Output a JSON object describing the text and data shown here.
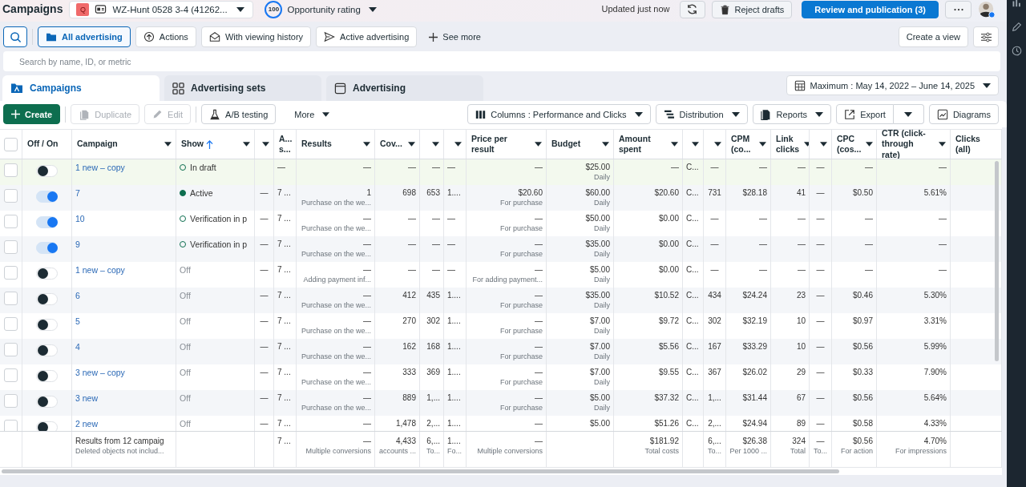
{
  "header": {
    "title": "Campaigns",
    "account": {
      "initial": "Q",
      "name": "WZ-Hunt 0528 3-4 (41262..."
    },
    "opportunity": {
      "score": "100",
      "label": "Opportunity rating"
    },
    "updated": "Updated just now",
    "reject": "Reject drafts",
    "publish": "Review and publication (3)"
  },
  "filters": [
    {
      "label": "All advertising",
      "selected": true
    },
    {
      "label": "Actions",
      "selected": false
    },
    {
      "label": "With viewing history",
      "selected": false
    },
    {
      "label": "Active advertising",
      "selected": false
    }
  ],
  "see_more": "See more",
  "create_view": "Create a view",
  "search": {
    "placeholder": "Search by name, ID, or metric"
  },
  "tabs": [
    {
      "label": "Campaigns",
      "selected": true
    },
    {
      "label": "Advertising sets",
      "selected": false
    },
    {
      "label": "Advertising",
      "selected": false
    }
  ],
  "date_range": "Maximum : May 14, 2022 – June 14, 2025",
  "toolbar": {
    "actions": [
      {
        "label": "Create",
        "disabled": false
      },
      {
        "label": "Duplicate",
        "disabled": true
      },
      {
        "label": "Edit",
        "disabled": true
      },
      {
        "label": "A/B testing",
        "disabled": false
      }
    ],
    "more": "More",
    "tools": [
      {
        "label": "Columns : Performance and Clicks",
        "kind": "menu"
      },
      {
        "label": "Distribution",
        "kind": "menu"
      },
      {
        "label": "Reports",
        "kind": "menu"
      },
      {
        "label": "Export",
        "kind": "split"
      },
      {
        "label": "Diagrams",
        "kind": "plain"
      }
    ]
  },
  "table": {
    "select_all": false,
    "fixed_columns": [
      {
        "label": "Off / On",
        "dropdown": false
      },
      {
        "label": "Campaign",
        "dropdown": true,
        "sorted": false
      },
      {
        "label": "Show",
        "dropdown": true,
        "sorted": true
      }
    ],
    "columns": [
      {
        "dropdown": true
      },
      {
        "label": "A... s..."
      },
      {
        "label": "Results",
        "dropdown": true
      },
      {
        "label": "Cov...",
        "dropdown": true
      },
      {
        "dropdown": true
      },
      {
        "dropdown": true
      },
      {
        "label": "Price per result",
        "dropdown": true
      },
      {
        "label": "Budget",
        "dropdown": true
      },
      {
        "label": "Amount spent",
        "dropdown": true
      },
      {
        "dropdown": true
      },
      {
        "dropdown": true
      },
      {
        "label": "CPM (co...",
        "dropdown": true
      },
      {
        "label": "Link clicks",
        "dropdown": true
      },
      {
        "dropdown": true
      },
      {
        "label": "CPC (cos...",
        "dropdown": true
      },
      {
        "label": "CTR (click-through rate)",
        "dropdown": true
      },
      {
        "label": "Clicks (all)",
        "dropdown": false
      }
    ],
    "rows": [
      {
        "selected": false,
        "on": false,
        "campaign": "1 new – copy",
        "status": {
          "label": "In draft",
          "kind": "draft"
        },
        "cells": [
          null,
          [
            "—"
          ],
          [
            "—"
          ],
          [
            "—"
          ],
          [
            "—"
          ],
          [
            "—"
          ],
          [
            "—"
          ],
          [
            "$25.00",
            "Daily"
          ],
          [
            "—"
          ],
          [
            "C..."
          ],
          [
            "—"
          ],
          [
            "—"
          ],
          [
            "—"
          ],
          [
            "—"
          ],
          [
            "—"
          ],
          [
            "—"
          ]
        ]
      },
      {
        "selected": false,
        "on": true,
        "campaign": "7",
        "status": {
          "label": "Active",
          "kind": "active"
        },
        "cells": [
          [
            "—"
          ],
          [
            "7 ..."
          ],
          [
            "1",
            "Purchase on the we..."
          ],
          [
            "698"
          ],
          [
            "653"
          ],
          [
            "1...."
          ],
          [
            "$20.60",
            "For purchase"
          ],
          [
            "$60.00",
            "Daily"
          ],
          [
            "$20.60"
          ],
          [
            "C..."
          ],
          [
            "731"
          ],
          [
            "$28.18"
          ],
          [
            "41"
          ],
          [
            "—"
          ],
          [
            "$0.50"
          ],
          [
            "5.61%"
          ]
        ]
      },
      {
        "selected": false,
        "on": true,
        "campaign": "10",
        "status": {
          "label": "Verification in p",
          "kind": "review"
        },
        "cells": [
          [
            "—"
          ],
          [
            "7 ..."
          ],
          [
            "—",
            "Purchase on the we..."
          ],
          [
            "—"
          ],
          [
            "—"
          ],
          [
            "—"
          ],
          [
            "—",
            "For purchase"
          ],
          [
            "$50.00",
            "Daily"
          ],
          [
            "$0.00"
          ],
          [
            "C..."
          ],
          [
            "—"
          ],
          [
            "—"
          ],
          [
            "—"
          ],
          [
            "—"
          ],
          [
            "—"
          ],
          [
            "—"
          ]
        ]
      },
      {
        "selected": false,
        "on": true,
        "campaign": "9",
        "status": {
          "label": "Verification in p",
          "kind": "review"
        },
        "cells": [
          [
            "—"
          ],
          [
            "7 ..."
          ],
          [
            "—",
            "Purchase on the we..."
          ],
          [
            "—"
          ],
          [
            "—"
          ],
          [
            "—"
          ],
          [
            "—",
            "For purchase"
          ],
          [
            "$35.00",
            "Daily"
          ],
          [
            "$0.00"
          ],
          [
            "C..."
          ],
          [
            "—"
          ],
          [
            "—"
          ],
          [
            "—"
          ],
          [
            "—"
          ],
          [
            "—"
          ],
          [
            "—"
          ]
        ]
      },
      {
        "selected": false,
        "on": false,
        "campaign": "1 new – copy",
        "status": {
          "label": "Off",
          "kind": "off"
        },
        "cells": [
          [
            "—"
          ],
          [
            "7 ..."
          ],
          [
            "—",
            "Adding payment inf..."
          ],
          [
            "—"
          ],
          [
            "—"
          ],
          [
            "—"
          ],
          [
            "—",
            "For adding payment..."
          ],
          [
            "$5.00",
            "Daily"
          ],
          [
            "$0.00"
          ],
          [
            "C..."
          ],
          [
            "—"
          ],
          [
            "—"
          ],
          [
            "—"
          ],
          [
            "—"
          ],
          [
            "—"
          ],
          [
            "—"
          ]
        ]
      },
      {
        "selected": false,
        "on": false,
        "campaign": "6",
        "status": {
          "label": "Off",
          "kind": "off"
        },
        "cells": [
          [
            "—"
          ],
          [
            "7 ..."
          ],
          [
            "—",
            "Purchase on the we..."
          ],
          [
            "412"
          ],
          [
            "435"
          ],
          [
            "1...."
          ],
          [
            "—",
            "For purchase"
          ],
          [
            "$35.00",
            "Daily"
          ],
          [
            "$10.52"
          ],
          [
            "C..."
          ],
          [
            "434"
          ],
          [
            "$24.24"
          ],
          [
            "23"
          ],
          [
            "—"
          ],
          [
            "$0.46"
          ],
          [
            "5.30%"
          ]
        ]
      },
      {
        "selected": false,
        "on": false,
        "campaign": "5",
        "status": {
          "label": "Off",
          "kind": "off"
        },
        "cells": [
          [
            "—"
          ],
          [
            "7 ..."
          ],
          [
            "—",
            "Purchase on the we..."
          ],
          [
            "270"
          ],
          [
            "302"
          ],
          [
            "1...."
          ],
          [
            "—",
            "For purchase"
          ],
          [
            "$7.00",
            "Daily"
          ],
          [
            "$9.72"
          ],
          [
            "C..."
          ],
          [
            "302"
          ],
          [
            "$32.19"
          ],
          [
            "10"
          ],
          [
            "—"
          ],
          [
            "$0.97"
          ],
          [
            "3.31%"
          ]
        ]
      },
      {
        "selected": false,
        "on": false,
        "campaign": "4",
        "status": {
          "label": "Off",
          "kind": "off"
        },
        "cells": [
          [
            "—"
          ],
          [
            "7 ..."
          ],
          [
            "—",
            "Purchase on the we..."
          ],
          [
            "162"
          ],
          [
            "168"
          ],
          [
            "1...."
          ],
          [
            "—",
            "For purchase"
          ],
          [
            "$7.00",
            "Daily"
          ],
          [
            "$5.56"
          ],
          [
            "C..."
          ],
          [
            "167"
          ],
          [
            "$33.29"
          ],
          [
            "10"
          ],
          [
            "—"
          ],
          [
            "$0.56"
          ],
          [
            "5.99%"
          ]
        ]
      },
      {
        "selected": false,
        "on": false,
        "campaign": "3 new – copy",
        "status": {
          "label": "Off",
          "kind": "off"
        },
        "cells": [
          [
            "—"
          ],
          [
            "7 ..."
          ],
          [
            "—",
            "Purchase on the we..."
          ],
          [
            "333"
          ],
          [
            "369"
          ],
          [
            "1...."
          ],
          [
            "—",
            "For purchase"
          ],
          [
            "$7.00",
            "Daily"
          ],
          [
            "$9.55"
          ],
          [
            "C..."
          ],
          [
            "367"
          ],
          [
            "$26.02"
          ],
          [
            "29"
          ],
          [
            "—"
          ],
          [
            "$0.33"
          ],
          [
            "7.90%"
          ]
        ]
      },
      {
        "selected": false,
        "on": false,
        "campaign": "3 new",
        "status": {
          "label": "Off",
          "kind": "off"
        },
        "cells": [
          [
            "—"
          ],
          [
            "7 ..."
          ],
          [
            "—",
            "Purchase on the we..."
          ],
          [
            "889"
          ],
          [
            "1,..."
          ],
          [
            "1...."
          ],
          [
            "—",
            "For purchase"
          ],
          [
            "$5.00",
            "Daily"
          ],
          [
            "$37.32"
          ],
          [
            "C..."
          ],
          [
            "1,..."
          ],
          [
            "$31.44"
          ],
          [
            "67"
          ],
          [
            "—"
          ],
          [
            "$0.56"
          ],
          [
            "5.64%"
          ]
        ]
      },
      {
        "selected": false,
        "on": false,
        "campaign": "2 new",
        "status": {
          "label": "Off",
          "kind": "off"
        },
        "cells": [
          [
            "—"
          ],
          [
            "7 ..."
          ],
          [
            "—"
          ],
          [
            "1,478"
          ],
          [
            "2,..."
          ],
          [
            "1...."
          ],
          [
            "—"
          ],
          [
            "$5.00"
          ],
          [
            "$51.26"
          ],
          [
            "C..."
          ],
          [
            "2,..."
          ],
          [
            "$24.94"
          ],
          [
            "89"
          ],
          [
            "—"
          ],
          [
            "$0.58"
          ],
          [
            "4.33%"
          ]
        ]
      }
    ],
    "footer": {
      "title": "Results from 12 campaig",
      "note": "Deleted objects not includ...",
      "cells": [
        null,
        [
          "7 ..."
        ],
        [
          "—",
          "Multiple conversions"
        ],
        [
          "4,433",
          "accounts ..."
        ],
        [
          "6,...",
          "To..."
        ],
        [
          "1....",
          "Fo..."
        ],
        [
          "—",
          "Multiple conversions"
        ],
        null,
        [
          "$181.92",
          "Total costs"
        ],
        null,
        [
          "6,...",
          "To..."
        ],
        [
          "$26.38",
          "Per 1000 ..."
        ],
        [
          "324",
          "Total"
        ],
        [
          "—",
          "To..."
        ],
        [
          "$0.56",
          "For action"
        ],
        [
          "4.70%",
          "For impressions"
        ]
      ]
    }
  }
}
